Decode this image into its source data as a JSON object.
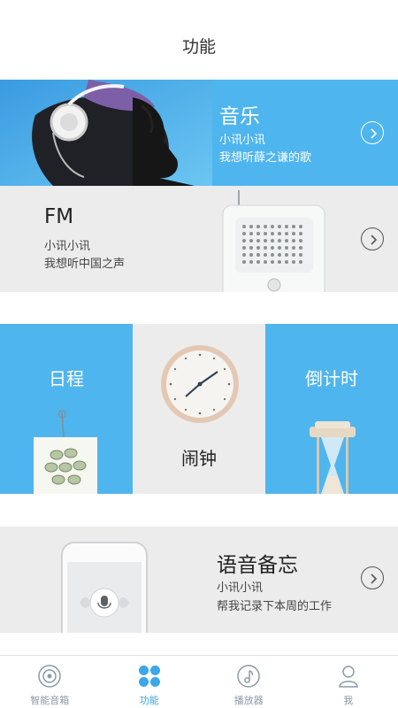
{
  "header": {
    "title": "功能"
  },
  "music": {
    "title": "音乐",
    "line1": "小讯小讯",
    "line2": "我想听薛之谦的歌"
  },
  "fm": {
    "title": "FM",
    "line1": "小讯小讯",
    "line2": "我想听中国之声"
  },
  "tiles": {
    "schedule": "日程",
    "alarm": "闹钟",
    "countdown": "倒计时"
  },
  "memo": {
    "title": "语音备忘",
    "line1": "小讯小讯",
    "line2": "帮我记录下本周的工作"
  },
  "tabbar": {
    "items": [
      {
        "label": "智能音箱",
        "icon": "speaker-icon",
        "active": false
      },
      {
        "label": "功能",
        "icon": "grid-icon",
        "active": true
      },
      {
        "label": "播放器",
        "icon": "music-note-icon",
        "active": false
      },
      {
        "label": "我",
        "icon": "person-icon",
        "active": false
      }
    ]
  },
  "colors": {
    "accent": "#4fb5ee",
    "tab_active": "#3aa8ea",
    "tab_inactive": "#8a9aa8",
    "card_gray": "#ececec"
  }
}
